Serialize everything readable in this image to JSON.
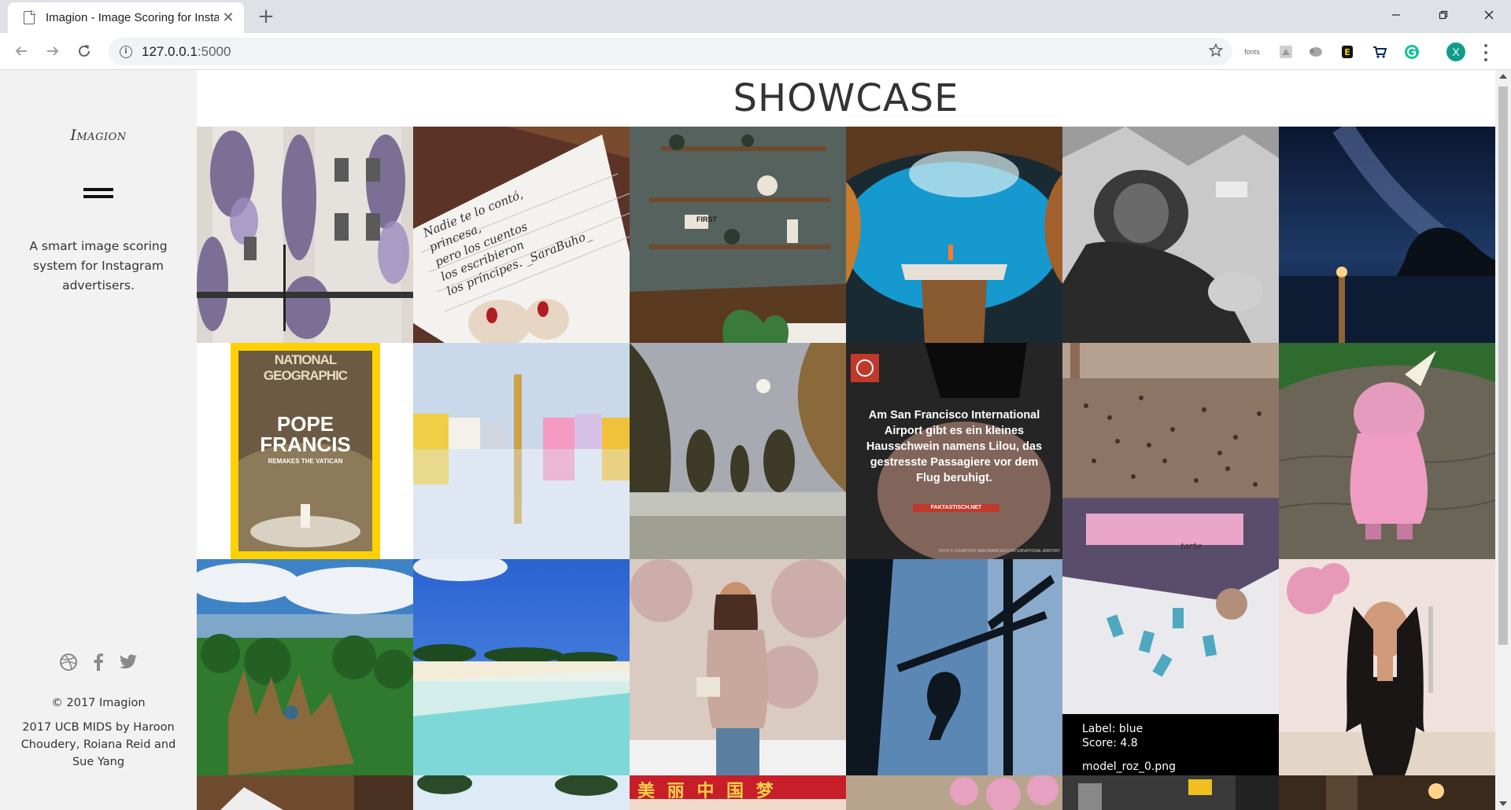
{
  "browser": {
    "tab_title": "Imagion - Image Scoring for Instagram",
    "url_host": "127.0.0.1",
    "url_port": ":5000",
    "ext_fonts_label": "fonts",
    "profile_initial": "X"
  },
  "sidebar": {
    "logo": "Imagion",
    "tagline": "A smart image scoring system for Instagram advertisers.",
    "social_icons": [
      "dribbble-icon",
      "facebook-icon",
      "twitter-icon"
    ],
    "copyright": "© 2017 Imagion",
    "credits": "2017 UCB MIDS by Haroon Choudery, Roiana Reid and Sue Yang"
  },
  "main": {
    "heading": "SHOWCASE",
    "tiles": [
      {
        "id": "house-wisteria",
        "colors": [
          "#d9d4cf",
          "#8a7aa8",
          "#4a4a4a"
        ]
      },
      {
        "id": "handwritten-note",
        "colors": [
          "#f3f1ee",
          "#6b3b2c",
          "#b22222"
        ]
      },
      {
        "id": "wall-shelves",
        "colors": [
          "#5b6660",
          "#6e4a2e",
          "#d9d0c2"
        ]
      },
      {
        "id": "cave-pool",
        "colors": [
          "#1a2c36",
          "#1fa3d4",
          "#c77b2b"
        ]
      },
      {
        "id": "climber-bw",
        "colors": [
          "#8c8c8c",
          "#2a2a2a",
          "#d9d9d9"
        ]
      },
      {
        "id": "night-sky",
        "colors": [
          "#0b1b33",
          "#1c3558",
          "#e2a45a"
        ]
      },
      {
        "id": "magazine-cover",
        "colors": [
          "#ffd100",
          "#6c5a42",
          "#ffffff"
        ]
      },
      {
        "id": "colorful-houses",
        "colors": [
          "#c8d9ea",
          "#e8c43c",
          "#f49ac1"
        ]
      },
      {
        "id": "tree-field",
        "colors": [
          "#a7a9b0",
          "#3d3a28",
          "#8a6e3d"
        ]
      },
      {
        "id": "pig-airport",
        "colors": [
          "#3a3a3a",
          "#c79b8a",
          "#c0392b"
        ]
      },
      {
        "id": "crowd-square",
        "colors": [
          "#8c7565",
          "#4a3a32",
          "#d2c0b0"
        ]
      },
      {
        "id": "pink-costume",
        "colors": [
          "#6b6658",
          "#e49bbd",
          "#3a7a3a"
        ]
      },
      {
        "id": "jungle-hand",
        "colors": [
          "#3f83c7",
          "#2f7a2f",
          "#8a6a3a"
        ]
      },
      {
        "id": "beach",
        "colors": [
          "#2f6fd6",
          "#7fd8d8",
          "#f3ecd8"
        ]
      },
      {
        "id": "woman-blossom",
        "colors": [
          "#d8c9c0",
          "#c8a89c",
          "#5b7fa0"
        ]
      },
      {
        "id": "industrial-silhouette",
        "colors": [
          "#5b87b5",
          "#0e1620",
          "#a9c1d8"
        ]
      },
      {
        "id": "cosmetics",
        "colors": [
          "#e7e7ec",
          "#5a4d6b",
          "#5fb6c8"
        ]
      },
      {
        "id": "woman-portrait",
        "colors": [
          "#f0e0dc",
          "#1b1616",
          "#d19a7a"
        ]
      },
      {
        "id": "row4-a",
        "colors": [
          "#6e4a2e"
        ]
      },
      {
        "id": "row4-b",
        "colors": [
          "#9cc9e8"
        ]
      },
      {
        "id": "row4-c",
        "colors": [
          "#c81e2a"
        ]
      },
      {
        "id": "row4-d",
        "colors": [
          "#b8a48c"
        ]
      },
      {
        "id": "row4-e",
        "colors": [
          "#3a3a3a"
        ]
      },
      {
        "id": "row4-f",
        "colors": [
          "#3a2a1e"
        ]
      }
    ],
    "magazine": {
      "brand": "NATIONAL GEOGRAPHIC",
      "line1": "POPE",
      "line2": "FRANCIS",
      "sub": "REMAKES THE VATICAN"
    },
    "handwriting": {
      "l1": "Nadie te lo contó,",
      "l2": "princesa,",
      "l3": "pero los cuentos",
      "l4": "los escribieron",
      "l5": "los príncipes. _SaraBuho_"
    },
    "shelf_sign": "FIRST",
    "pig_post": {
      "text": "Am San Francisco International Airport gibt es ein kleines Hausschwein namens Lilou, das gestresste Passagiere vor dem Flug beruhigt.",
      "source": "FAKTASTISCH.NET",
      "photo_credit": "FOTO © COURTESY SAN FRANCISCO INTERNATIONAL AIRPORT"
    },
    "cosmetics_brand": "tarte",
    "row4_sign": "美 丽 中 国 梦",
    "hover_caption": {
      "label": "Label: blue",
      "score": "Score: 4.8",
      "filename": "model_roz_0.png"
    }
  }
}
